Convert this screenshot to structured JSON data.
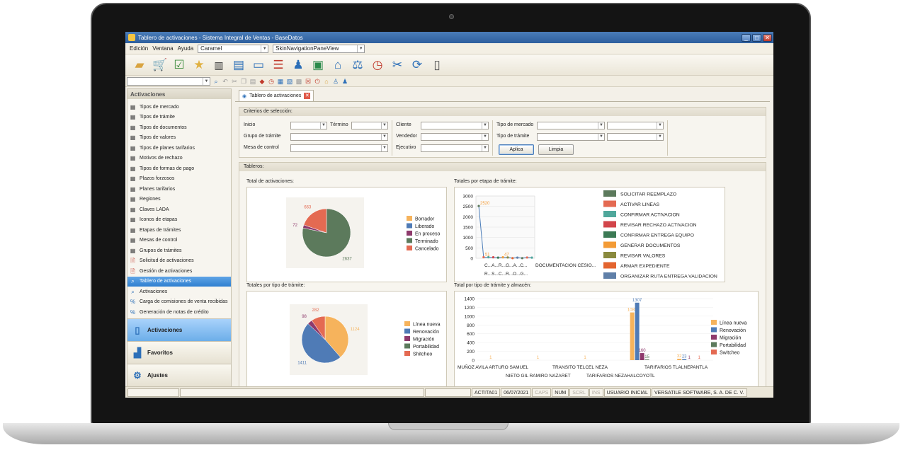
{
  "window": {
    "title": "Tablero de activaciones - Sistema Integral de Ventas - BaseDatos"
  },
  "menu": {
    "items": [
      "Edición",
      "Ventana",
      "Ayuda"
    ],
    "skin_value": "Caramel",
    "navpane_value": "SkinNavigationPaneView"
  },
  "toolbar": {
    "icons": [
      "folder-open-icon",
      "cart-icon",
      "check-report-icon",
      "folder-star-icon",
      "barcode-icon",
      "document-icon",
      "id-card-icon",
      "book-stack-icon",
      "users-icon",
      "money-icon",
      "bank-icon",
      "scale-icon",
      "clock-icon",
      "tools-icon",
      "sync-icon",
      "phone-icon"
    ]
  },
  "sidebar": {
    "header": "Activaciones",
    "items": [
      {
        "label": "Tipos de mercado",
        "icon": "grid-icon"
      },
      {
        "label": "Tipos de trámite",
        "icon": "grid-icon"
      },
      {
        "label": "Tipos de documentos",
        "icon": "grid-icon"
      },
      {
        "label": "Tipos de valores",
        "icon": "grid-icon"
      },
      {
        "label": "Tipos de planes tarifarios",
        "icon": "grid-icon"
      },
      {
        "label": "Motivos de rechazo",
        "icon": "grid-icon"
      },
      {
        "label": "Tipos de formas de pago",
        "icon": "grid-icon"
      },
      {
        "label": "Plazos forzosos",
        "icon": "grid-icon"
      },
      {
        "label": "Planes tarifarios",
        "icon": "grid-icon"
      },
      {
        "label": "Regiones",
        "icon": "grid-icon"
      },
      {
        "label": "Claves LADA",
        "icon": "grid-icon"
      },
      {
        "label": "Iconos de etapas",
        "icon": "grid-icon"
      },
      {
        "label": "Etapas de trámites",
        "icon": "grid-icon"
      },
      {
        "label": "Mesas de control",
        "icon": "grid-icon"
      },
      {
        "label": "Grupos de trámites",
        "icon": "grid-icon"
      },
      {
        "label": "Solicitud de activaciones",
        "icon": "doc-red-icon"
      },
      {
        "label": "Gestión de activaciones",
        "icon": "doc-red-icon"
      },
      {
        "label": "Tablero de activaciones",
        "icon": "search-icon"
      },
      {
        "label": "Activaciones",
        "icon": "search-icon"
      },
      {
        "label": "Carga de comisiones de venta recibidas",
        "icon": "percent-icon"
      },
      {
        "label": "Generación de notas de crédito",
        "icon": "percent-icon"
      }
    ],
    "buttons": [
      {
        "label": "Activaciones",
        "icon": "phone-icon"
      },
      {
        "label": "Favoritos",
        "icon": "blocks-icon"
      },
      {
        "label": "Ajustes",
        "icon": "gears-icon"
      }
    ]
  },
  "tab": {
    "label": "Tablero de activaciones"
  },
  "criteria": {
    "title": "Criterios de selección:",
    "inicio": "Inicio",
    "termino": "Término",
    "grupo": "Grupo de trámite",
    "mesa": "Mesa de control",
    "cliente": "Cliente",
    "vendedor": "Vendedor",
    "ejecutivo": "Ejecutivo",
    "tipo_mercado": "Tipo de mercado",
    "tipo_tramite": "Tipo de trámite",
    "aplica": "Aplica",
    "limpia": "Limpia"
  },
  "tableros": {
    "title": "Tableros:",
    "total_title": "Total de activaciones:",
    "etapa_title": "Totales por etapa de trámite:",
    "tipo_title": "Totales por tipo de trámite:",
    "almacen_title": "Total por tipo de trámite y almacén:"
  },
  "chart_data": [
    {
      "type": "pie",
      "title": "Total de activaciones:",
      "series": [
        {
          "name": "Borrador",
          "value": 0,
          "color": "#f6b35c"
        },
        {
          "name": "Liberado",
          "value": 0,
          "color": "#4f7bb6"
        },
        {
          "name": "En proceso",
          "value": 0,
          "color": "#8e3a6c"
        },
        {
          "name": "Terminado",
          "value": 2637,
          "color": "#5c7a5c"
        },
        {
          "name": "Cancelado",
          "value": 663,
          "color": "#e46a52"
        }
      ],
      "extra_label": "72",
      "extra_value": 72
    },
    {
      "type": "line",
      "title": "Totales por etapa de trámite:",
      "ylim": [
        0,
        3000
      ],
      "yticks": [
        0,
        500,
        1000,
        1500,
        2000,
        2500,
        3000
      ],
      "x_labels": [
        "C...A...R...G...A...C...",
        "DOCUMENTACION CESIO...",
        "R...S...C...R...O...G..."
      ],
      "values": [
        2520,
        51,
        50,
        49,
        29,
        47,
        40,
        6,
        30,
        6,
        37,
        30
      ],
      "point_labels": [
        "2520",
        "51",
        "",
        "",
        "",
        "47",
        "",
        "",
        "",
        "",
        "",
        ""
      ],
      "legend": [
        {
          "name": "SOLICITAR REEMPLAZO",
          "color": "#5c7a5c"
        },
        {
          "name": "ACTIVAR LINEAS",
          "color": "#e46a52"
        },
        {
          "name": "CONFIRMAR ACTIVACION",
          "color": "#4fa79b"
        },
        {
          "name": "REVISAR RECHAZO ACTIVACION",
          "color": "#d2454a"
        },
        {
          "name": "CONFIRMAR ENTREGA EQUIPO",
          "color": "#3c7a55"
        },
        {
          "name": "GENERAR DOCUMENTOS",
          "color": "#f39b36"
        },
        {
          "name": "REVISAR VALORES",
          "color": "#8a8a3e"
        },
        {
          "name": "ARMAR EXPEDIENTE",
          "color": "#e3642f"
        },
        {
          "name": "ORGANIZAR RUTA ENTREGA VALIDACION",
          "color": "#5f7fa8"
        }
      ]
    },
    {
      "type": "pie",
      "title": "Totales por tipo de trámite:",
      "series": [
        {
          "name": "Línea nueva",
          "value": 1124,
          "color": "#f6b35c"
        },
        {
          "name": "Renovación",
          "value": 1411,
          "color": "#4f7bb6"
        },
        {
          "name": "Migración",
          "value": 98,
          "color": "#8e3a6c"
        },
        {
          "name": "Portabilidad",
          "value": 0,
          "color": "#5c7a5c"
        },
        {
          "name": "Shitcheo",
          "value": 282,
          "color": "#e46a52"
        }
      ]
    },
    {
      "type": "bar",
      "title": "Total por tipo de trámite y almacén:",
      "ylim": [
        0,
        1400
      ],
      "yticks": [
        0,
        200,
        400,
        600,
        800,
        1000,
        1200,
        1400
      ],
      "categories": [
        "MUÑOZ AVILA ARTURO SAMUEL",
        "NIETO GIL RAMIRO NAZARET",
        "TRANSITO TELCEL NEZA",
        "TARIFARIOS NEZAHALCOYOTL",
        "TARIFARIOS TLALNEPANTLA"
      ],
      "series": [
        {
          "name": "Línea nueva",
          "color": "#f6b35c",
          "values": [
            1,
            1,
            1,
            1085,
            32
          ]
        },
        {
          "name": "Renovación",
          "color": "#4f7bb6",
          "values": [
            0,
            0,
            0,
            1307,
            23
          ]
        },
        {
          "name": "Migración",
          "color": "#8e3a6c",
          "values": [
            0,
            0,
            0,
            160,
            1
          ]
        },
        {
          "name": "Portabilidad",
          "color": "#5c7a5c",
          "values": [
            0,
            0,
            0,
            15,
            0
          ]
        },
        {
          "name": "Switcheo",
          "color": "#e46a52",
          "values": [
            0,
            0,
            0,
            0,
            1
          ]
        }
      ]
    }
  ],
  "status": {
    "cells": [
      "ACTITA01",
      "06/07/2021",
      "CAPS",
      "NUM",
      "SCRL",
      "INS",
      "USUARIO INICIAL",
      "VERSATILE SOFTWARE, S. A. DE C. V."
    ],
    "dim": [
      false,
      false,
      true,
      false,
      true,
      true,
      false,
      false
    ]
  }
}
